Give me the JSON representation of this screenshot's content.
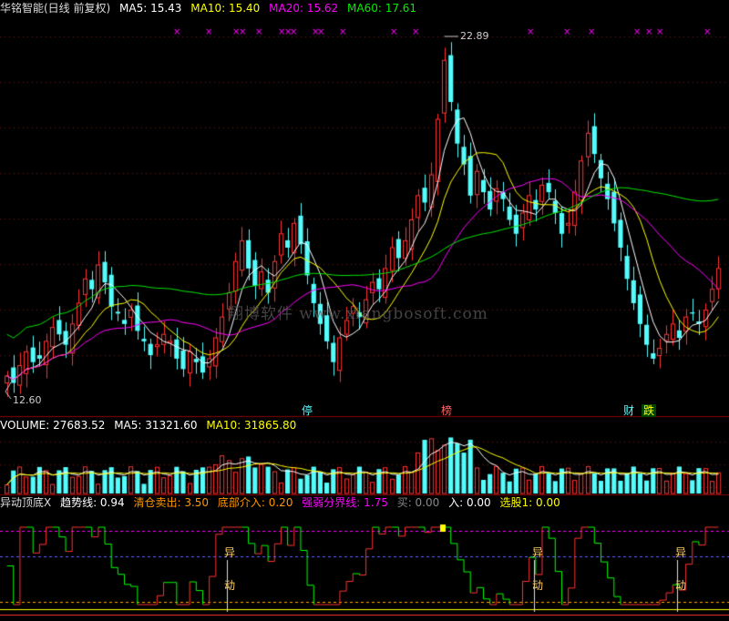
{
  "header_main": {
    "title": "华铭智能(日线 前复权)",
    "ma5": "MA5: 15.43",
    "ma10": "MA10: 15.40",
    "ma20": "MA20: 15.62",
    "ma60": "MA60: 17.61"
  },
  "header_volume": {
    "volume": "VOLUME: 27683.52",
    "ma5": "MA5: 31321.60",
    "ma10": "MA10: 31865.80"
  },
  "header_indicator": {
    "name": "异动顶底X",
    "trend": "趋势线: 0.94",
    "sell": "清仓卖出: 3.50",
    "bottom": "底部介入: 0.20",
    "divide": "强弱分界线: 1.75",
    "buy_label": "买: 0.00",
    "in_label": "入: 0.00",
    "pick": "选股1: 0.00"
  },
  "price_labels": {
    "high": "22.89",
    "low": "12.60"
  },
  "badges": [
    "停",
    "榜",
    "财",
    "跌"
  ],
  "signal_marks": [
    "异",
    "动"
  ],
  "watermark": "翔博软件 www.xiangbosoft.com",
  "colors": {
    "up": "#ff3232",
    "down": "#54fcfc",
    "ma5": "#ffffff",
    "ma10": "#ffff00",
    "ma20": "#ff00ff",
    "ma60": "#00e600",
    "grid": "#8b0000",
    "dots": "#ff00ff",
    "ind_up": "#ff3232",
    "ind_down": "#00ff00",
    "sell_line": "#ff00ff",
    "mid_line": "#6464ff",
    "bottom_line": "#ffaa00"
  },
  "chart_data": {
    "type": "candlestick",
    "price_range": [
      12.6,
      22.89
    ],
    "close": [
      13.1,
      12.9,
      13.4,
      13.8,
      13.5,
      13.6,
      14.1,
      14.5,
      14.3,
      14.0,
      14.6,
      15.2,
      15.9,
      15.6,
      16.3,
      15.8,
      15.1,
      14.9,
      14.6,
      15.0,
      14.4,
      14.1,
      13.7,
      14.0,
      14.3,
      14.1,
      13.6,
      13.3,
      13.8,
      13.5,
      13.2,
      13.6,
      14.2,
      14.8,
      15.5,
      16.4,
      17.0,
      16.2,
      15.7,
      16.1,
      15.5,
      16.4,
      17.2,
      16.8,
      17.5,
      16.9,
      16.0,
      15.2,
      14.6,
      14.1,
      13.5,
      14.2,
      14.7,
      15.1,
      14.8,
      15.3,
      15.8,
      15.6,
      16.2,
      16.8,
      16.5,
      17.0,
      17.6,
      18.3,
      18.1,
      18.9,
      20.5,
      22.2,
      21.0,
      19.8,
      19.2,
      18.3,
      19.0,
      18.4,
      17.9,
      18.5,
      18.2,
      17.6,
      17.2,
      17.8,
      18.3,
      17.9,
      18.6,
      18.4,
      17.8,
      17.2,
      17.5,
      18.4,
      19.3,
      20.1,
      19.5,
      18.8,
      18.2,
      17.5,
      16.8,
      15.9,
      15.2,
      14.6,
      14.0,
      13.6,
      13.9,
      14.3,
      14.6,
      14.2,
      14.8,
      14.9,
      14.6,
      15.0,
      15.6,
      16.2
    ],
    "volume_scale_max": 80000
  }
}
